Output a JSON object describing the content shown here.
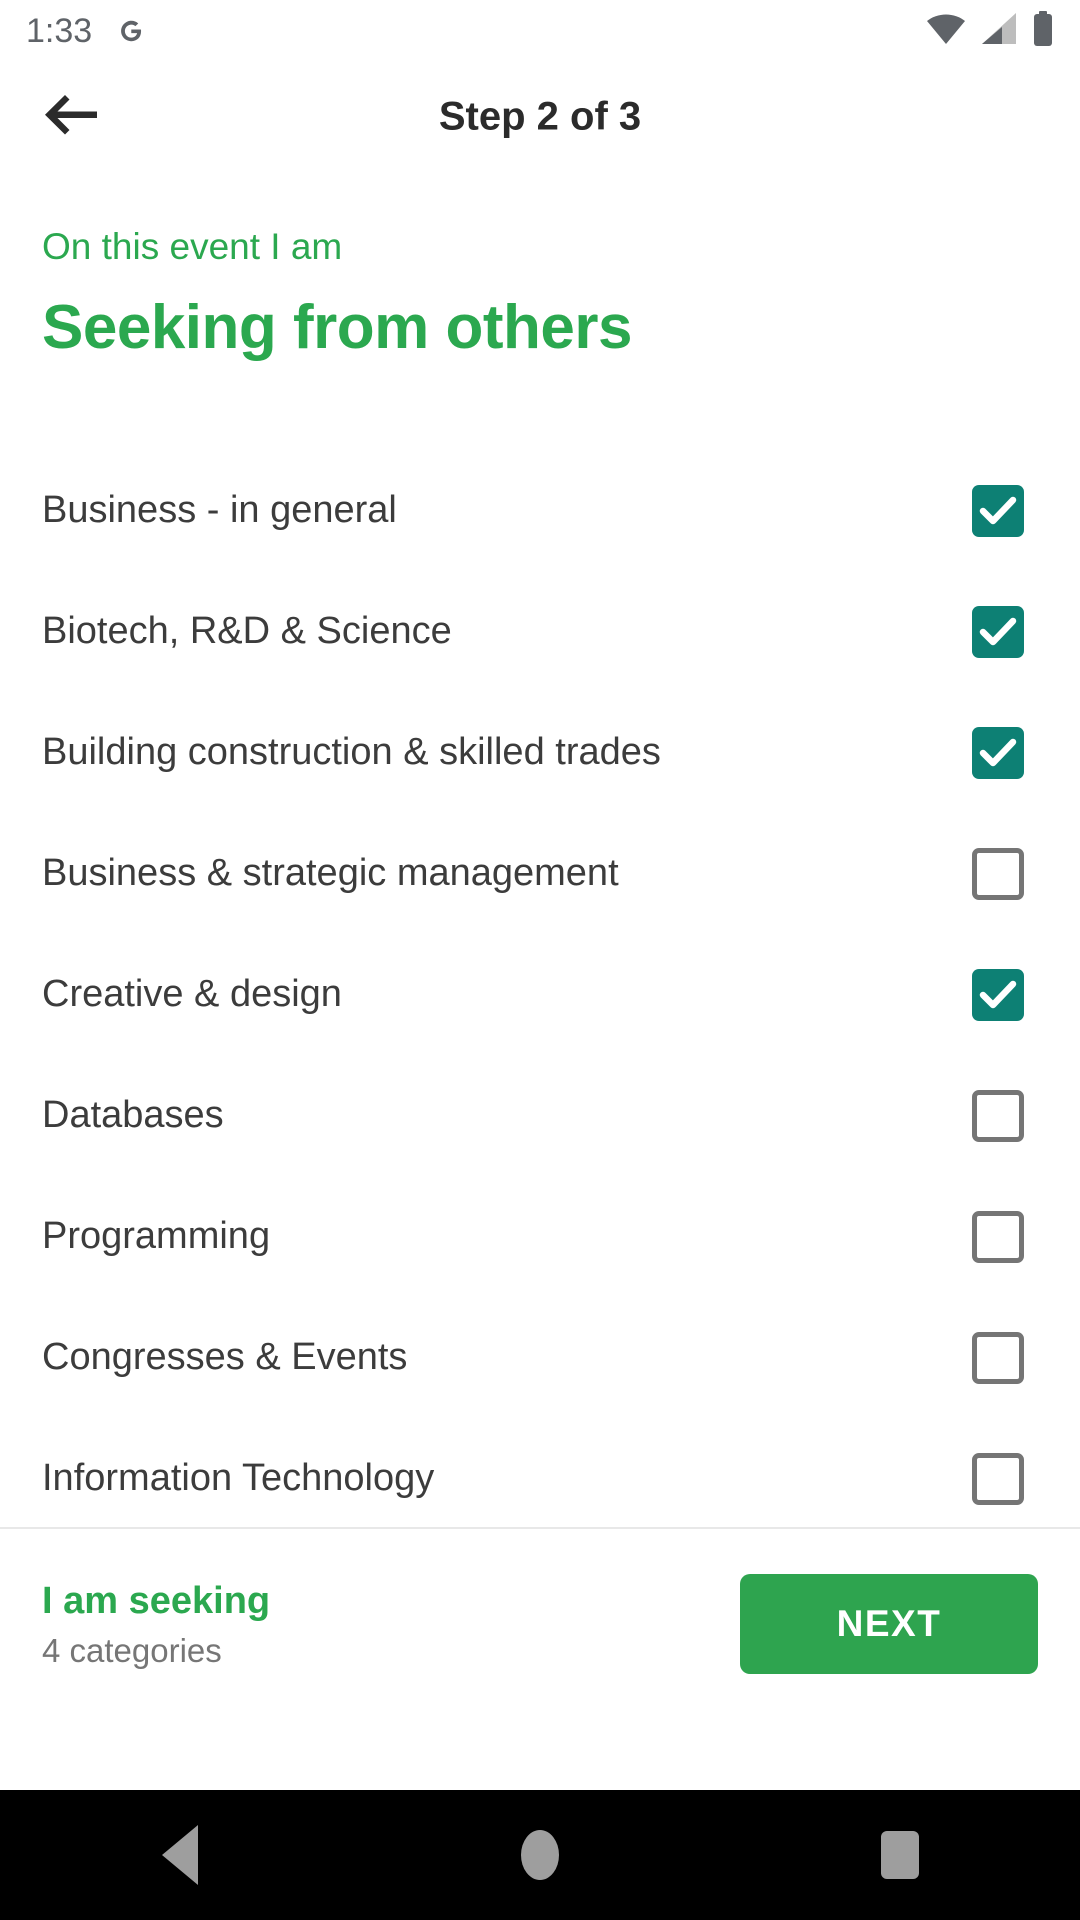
{
  "status_bar": {
    "time": "1:33",
    "notification_icon": "google-g-icon",
    "icons": [
      "wifi-icon",
      "cellular-signal-icon",
      "battery-icon"
    ]
  },
  "app_bar": {
    "back_icon": "back-arrow-icon",
    "title": "Step 2 of 3"
  },
  "header": {
    "eyebrow": "On this event I am",
    "title": "Seeking from others"
  },
  "categories": [
    {
      "label": "Business - in general",
      "checked": true
    },
    {
      "label": "Biotech, R&D & Science",
      "checked": true
    },
    {
      "label": "Building construction & skilled trades",
      "checked": true
    },
    {
      "label": "Business & strategic management",
      "checked": false
    },
    {
      "label": "Creative & design",
      "checked": true
    },
    {
      "label": "Databases",
      "checked": false
    },
    {
      "label": "Programming",
      "checked": false
    },
    {
      "label": "Congresses & Events",
      "checked": false
    },
    {
      "label": "Information Technology",
      "checked": false
    }
  ],
  "footer": {
    "summary_title": "I am seeking",
    "summary_count": "4 categories",
    "next_label": "NEXT"
  },
  "nav_bar": {
    "back": "nav-back-icon",
    "home": "nav-home-icon",
    "recents": "nav-recents-icon"
  },
  "colors": {
    "brand_green": "#2ba84f",
    "checkbox_teal": "#0d8074",
    "button_green": "#2ea44f",
    "text_dark": "#3c3c3c",
    "text_muted": "#767676"
  }
}
